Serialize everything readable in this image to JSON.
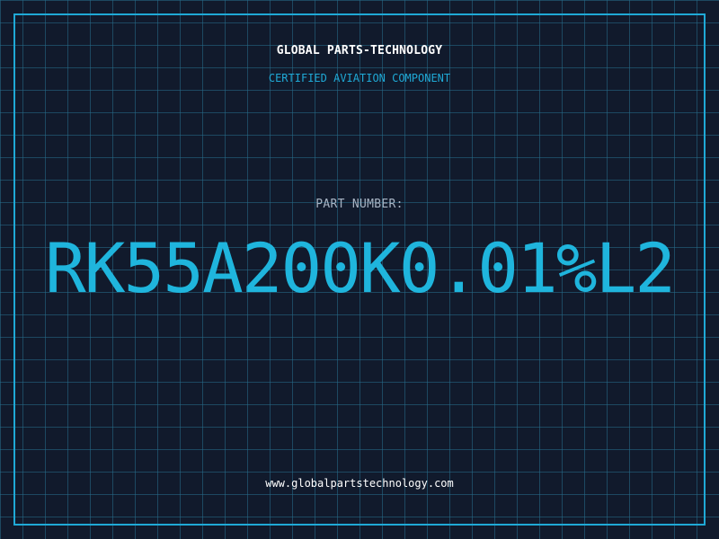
{
  "header": {
    "company": "GLOBAL PARTS-TECHNOLOGY",
    "subtitle": "CERTIFIED AVIATION COMPONENT"
  },
  "part": {
    "label": "PART NUMBER:",
    "number": "RK55A200K0.01%L2"
  },
  "footer": {
    "url": "www.globalpartstechnology.com"
  },
  "colors": {
    "background": "#111a2c",
    "grid": "#266e8c",
    "accent": "#1fa9d6",
    "part_number": "#1fb5dd",
    "text": "#ffffff",
    "label": "#a8b4c4"
  }
}
